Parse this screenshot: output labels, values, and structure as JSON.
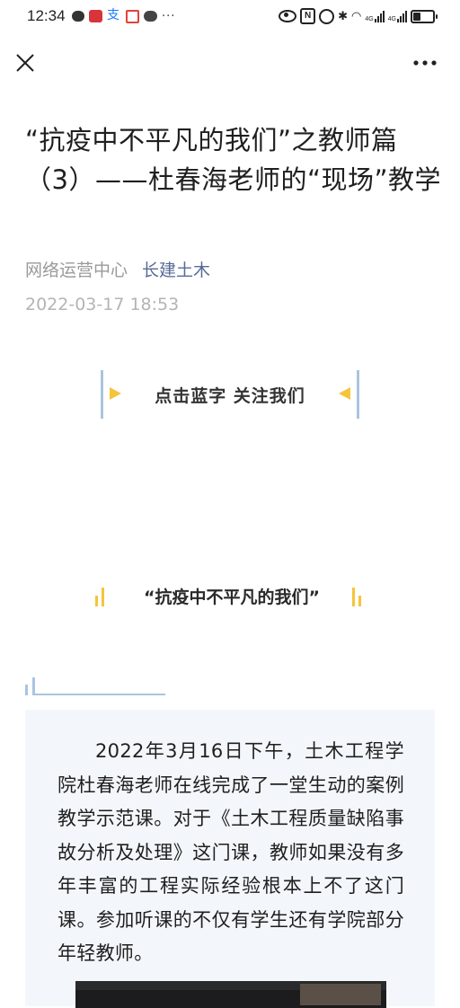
{
  "status_bar": {
    "time": "12:34",
    "left_icons": [
      "chat-icon",
      "app-red-icon",
      "alipay-icon",
      "redbook-icon",
      "wechat-icon",
      "more-dots-icon"
    ],
    "more_text": "···",
    "right_icons": [
      "eye-comfort-icon",
      "nfc-icon",
      "alarm-icon",
      "bluetooth-icon",
      "wifi-icon",
      "signal-4g-icon",
      "signal-4g-icon",
      "battery-icon"
    ],
    "net_label_1": "4G",
    "net_label_2": "4G"
  },
  "nav": {
    "close_icon": "close-icon",
    "more_icon": "more-icon"
  },
  "article": {
    "title": "“抗疫中不平凡的我们”之教师篇（3）——杜春海老师的“现场”教学",
    "author": "网络运营中心",
    "account": "长建土木",
    "date": "2022-03-17 18:53"
  },
  "follow_banner": {
    "text": "点击蓝字 关注我们"
  },
  "section": {
    "heading": "“抗疫中不平凡的我们”"
  },
  "body": {
    "paragraph": "2022年3月16日下午，土木工程学院杜春海老师在线完成了一堂生动的案例教学示范课。对于《土木工程质量缺陷事故分析及处理》这门课，教师如果没有多年丰富的工程实际经验根本上不了这门课。参加听课的不仅有学生还有学院部分年轻教师。"
  },
  "colors": {
    "link_blue": "#576b95",
    "meta_gray": "#9a9a9a",
    "date_gray": "#b4b4b4",
    "accent_yellow": "#f5c43b",
    "accent_blue": "#a9c5df",
    "content_bg": "#f3f7fb"
  }
}
